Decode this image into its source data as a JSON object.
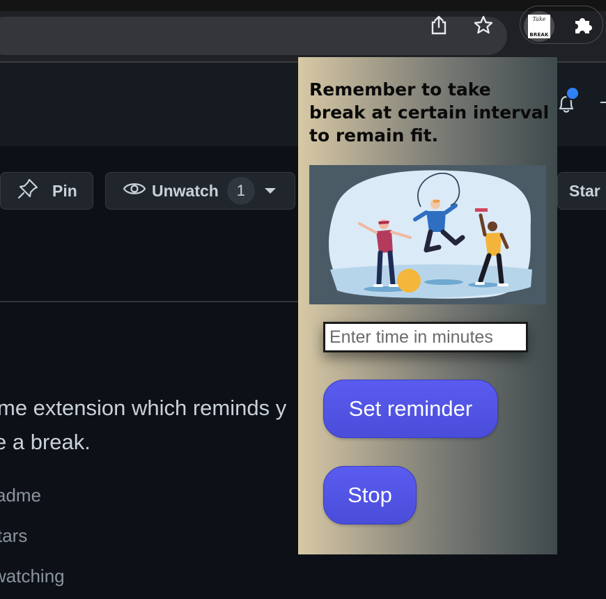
{
  "browser": {
    "icons": [
      "share-icon",
      "bookmark-star-icon",
      "take-break-extension-icon",
      "extensions-puzzle-icon"
    ],
    "extension_logo": {
      "line1": "Take",
      "line2": "BREAK"
    }
  },
  "github": {
    "pin_label": "Pin",
    "unwatch_label": "Unwatch",
    "watch_count": "1",
    "star_label": "Star",
    "about_line1": "me extension which reminds y",
    "about_line2": "e a break.",
    "meta": [
      "adme",
      "tars",
      "watching"
    ]
  },
  "popup": {
    "title": "Remember to take break at certain interval to remain fit.",
    "time_input_placeholder": "Enter time in minutes",
    "time_input_value": "",
    "set_reminder_label": "Set reminder",
    "stop_label": "Stop",
    "illustration": "people-exercising-illustration"
  },
  "colors": {
    "accent_button": "#5053e6",
    "page_bg": "#0d1117",
    "notification_dot": "#2f81f7"
  }
}
